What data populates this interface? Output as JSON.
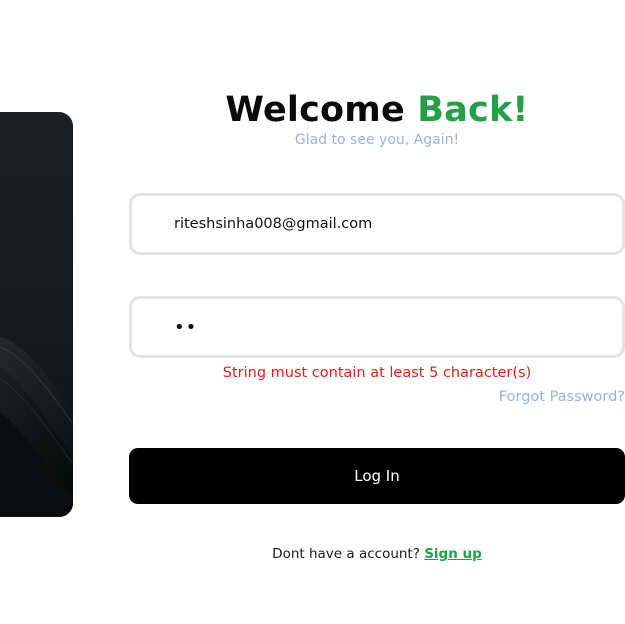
{
  "header": {
    "title_main": "Welcome",
    "title_accent": "Back!",
    "subtitle": "Glad to see you, Again!"
  },
  "form": {
    "email_value": "riteshsinha008@gmail.com",
    "password_value": "••",
    "error_message": "String must contain at least 5 character(s)",
    "forgot_password_label": "Forgot Password?",
    "login_label": "Log In"
  },
  "footer": {
    "prompt_text": "Dont have a account?",
    "signup_label": "Sign up"
  },
  "colors": {
    "accent": "#24a148",
    "muted": "#9fb1d6",
    "error": "#e01e1e",
    "button_bg": "#000000",
    "panel_bg": "#1a1d1f"
  },
  "icons": [
    "decorative-wave-panel"
  ]
}
